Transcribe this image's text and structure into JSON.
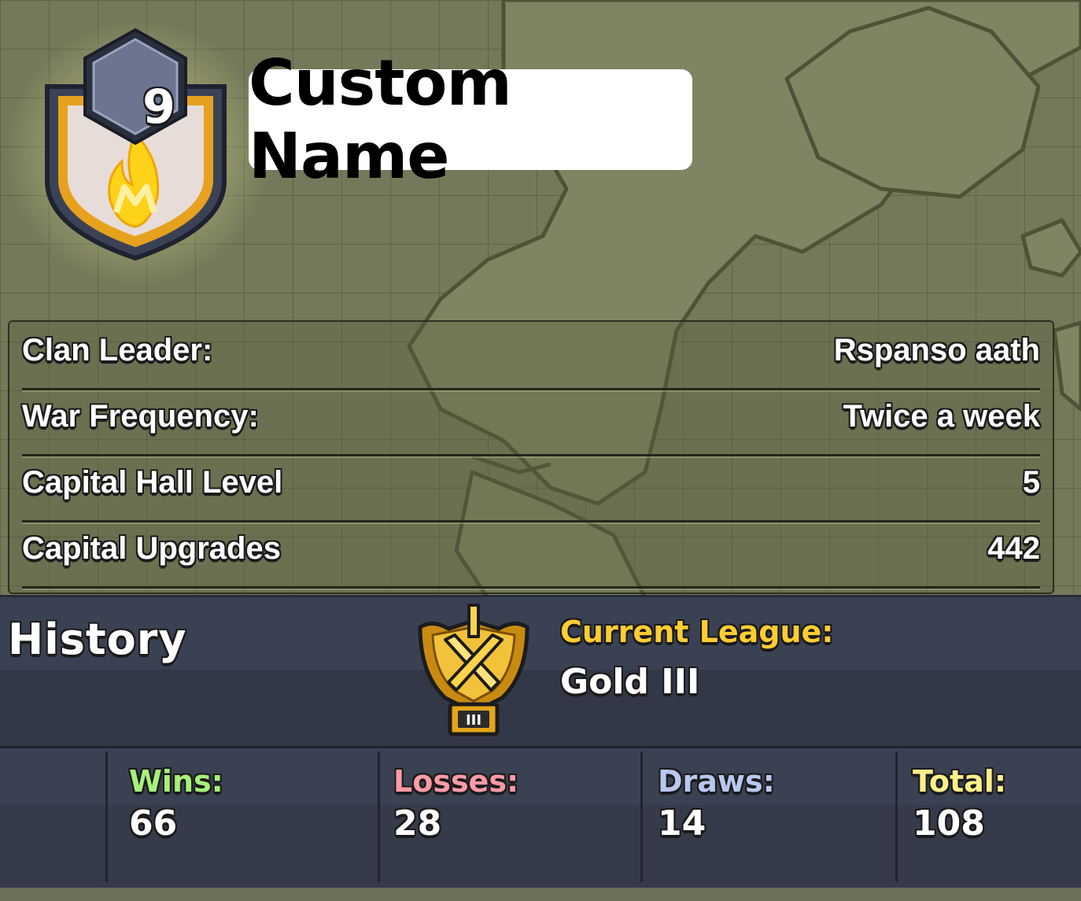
{
  "clan": {
    "level": "9",
    "name": "Custom Name"
  },
  "info": {
    "rows": [
      {
        "label": "Clan Leader:",
        "value": "Rspanso aath"
      },
      {
        "label": "War Frequency:",
        "value": "Twice a week"
      },
      {
        "label": "Capital Hall Level",
        "value": "5"
      },
      {
        "label": "Capital Upgrades",
        "value": "442"
      }
    ]
  },
  "history": {
    "title": "History",
    "league_label": "Current League:",
    "league_value": "Gold III",
    "league_tier": "III",
    "league_icon": "gold-crossed-swords-league-icon"
  },
  "stats": {
    "wins_label": "Wins:",
    "wins_value": "66",
    "losses_label": "Losses:",
    "losses_value": "28",
    "draws_label": "Draws:",
    "draws_value": "14",
    "total_label": "Total:",
    "total_value": "108"
  },
  "colors": {
    "map_bg": "#6f7453",
    "history_bg": "#3a4152",
    "league_label": "#ffcc33",
    "wins": "#a8f07a",
    "losses": "#ff9aa6",
    "draws": "#b8c8ee",
    "total": "#fff08a"
  }
}
